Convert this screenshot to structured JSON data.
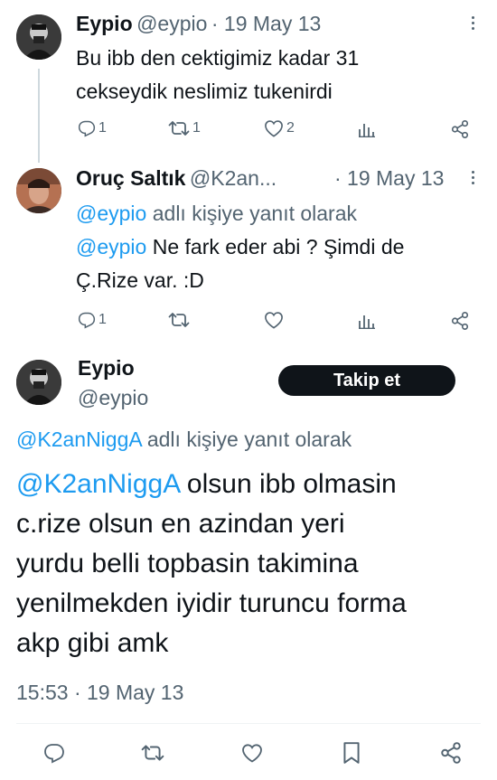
{
  "tweets": [
    {
      "author_name": "Eypio",
      "author_handle": "@eypio",
      "date": "· 19 May 13",
      "text_lines": [
        "Bu ibb den cektigimiz kadar 31",
        "cekseydik neslimiz tukenirdi"
      ],
      "replies": "1",
      "retweets": "1",
      "likes": "2"
    },
    {
      "author_name": "Oruç Saltık",
      "author_handle": "@K2an...",
      "date": "· 19 May 13",
      "reply_mention": "@eypio",
      "reply_suffix": " adlı kişiye yanıt olarak",
      "mention": "@eypio",
      "text_first": " Ne fark eder abi ? Şimdi de",
      "text_second": "Ç.Rize var. :D",
      "replies": "1",
      "retweets": "",
      "likes": ""
    }
  ],
  "main_tweet": {
    "author_name": "Eypio",
    "author_handle": "@eypio",
    "follow_label": "Takip et",
    "reply_mention": "@K2anNiggA",
    "reply_suffix": " adlı kişiye yanıt olarak",
    "mention": "@K2anNiggA",
    "text_first": " olsun ibb olmasin",
    "text_lines": [
      "c.rize olsun en azindan yeri",
      "yurdu belli topbasin takimina",
      "yenilmekden iyidir turuncu forma",
      "akp gibi amk"
    ],
    "timestamp": "15:53 · 19 May 13"
  },
  "colors": {
    "accent": "#1d9bf0",
    "text": "#0f1419",
    "muted": "#536471",
    "button_bg": "#0f1419"
  },
  "icons": [
    "reply-icon",
    "retweet-icon",
    "like-icon",
    "views-icon",
    "share-icon",
    "bookmark-icon",
    "more-icon"
  ]
}
